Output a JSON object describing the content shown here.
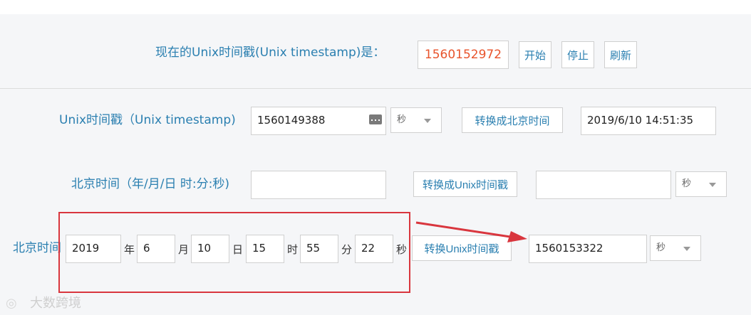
{
  "header": {
    "label": "现在的Unix时间戳(Unix timestamp)是：",
    "current_timestamp": "1560152972",
    "start_label": "开始",
    "stop_label": "停止",
    "refresh_label": "刷新"
  },
  "row1": {
    "label": "Unix时间戳（Unix timestamp)",
    "input_value": "1560149388",
    "unit_value": "秒",
    "convert_label": "转换成北京时间",
    "result_value": "2019/6/10 14:51:35"
  },
  "row2": {
    "label": "北京时间（年/月/日 时:分:秒)",
    "input_value": "",
    "convert_label": "转换成Unix时间戳",
    "result_value": "",
    "unit_value": "秒"
  },
  "row3": {
    "label": "北京时间",
    "year": "2019",
    "year_unit": "年",
    "month": "6",
    "month_unit": "月",
    "day": "10",
    "day_unit": "日",
    "hour": "15",
    "hour_unit": "时",
    "minute": "55",
    "minute_unit": "分",
    "second": "22",
    "second_unit": "秒",
    "convert_label": "转换Unix时间戳",
    "result_value": "1560153322",
    "unit_value": "秒"
  },
  "watermark": "大数跨境",
  "colors": {
    "accent": "#2a7fb0",
    "timestamp": "#e8542c",
    "highlight": "#d9363e"
  }
}
